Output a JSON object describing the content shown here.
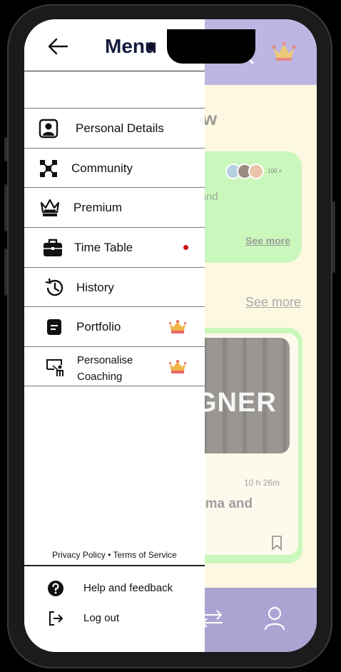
{
  "drawer": {
    "title": "Menu",
    "items": [
      {
        "label": "Personal Details",
        "icon": "user-square-icon"
      },
      {
        "label": "Community",
        "icon": "community-icon"
      },
      {
        "label": "Premium",
        "icon": "crown-icon"
      },
      {
        "label": "Time Table",
        "icon": "briefcase-icon",
        "dot_color": "#cc1111"
      },
      {
        "label": "History",
        "icon": "history-icon"
      },
      {
        "label": "Portfolio",
        "icon": "portfolio-icon",
        "premium": true
      },
      {
        "label_line1": "Personalise",
        "label_line2": "Coaching",
        "icon": "coaching-icon",
        "premium": true
      }
    ],
    "policy": "Privacy Policy • Terms of Service",
    "footer": {
      "help": "Help and feedback",
      "logout": "Log out"
    }
  },
  "background": {
    "heading_fragment": "w",
    "card1": {
      "avatar_count": "100 +",
      "text_fragment": "shed and",
      "see_more": "See more"
    },
    "see_more": "See more",
    "card2": {
      "image_word": "GNER",
      "duration": "10 h 26m",
      "title_fragment": "gma  and"
    }
  },
  "colors": {
    "header_purple": "#a79ed9",
    "bottom_purple": "#8f86c4",
    "card_green": "#b8f4a6",
    "page_cream": "#fdf6d8",
    "menu_title_navy": "#151b3d"
  }
}
